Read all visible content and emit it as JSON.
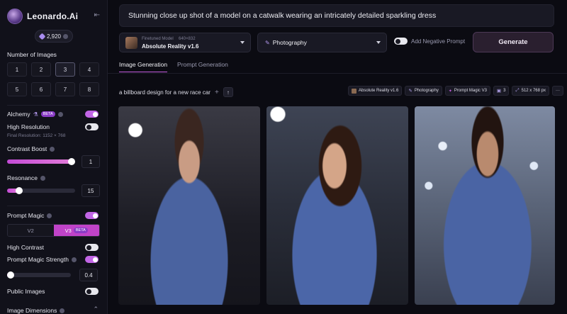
{
  "app": {
    "name": "Leonardo.Ai",
    "token_count": "2,920"
  },
  "sidebar": {
    "number_of_images_label": "Number of Images",
    "number_options": [
      "1",
      "2",
      "3",
      "4",
      "5",
      "6",
      "7",
      "8"
    ],
    "number_selected": "3",
    "alchemy_label": "Alchemy",
    "alchemy_badge": "BETA",
    "alchemy_on": true,
    "high_resolution_label": "High Resolution",
    "high_resolution_on": false,
    "final_resolution": "Final Resolution: 1152 × 768",
    "contrast_boost_label": "Contrast Boost",
    "contrast_boost_value": "1",
    "contrast_boost_fraction": 0.95,
    "resonance_label": "Resonance",
    "resonance_value": "15",
    "resonance_fraction": 0.18,
    "prompt_magic_label": "Prompt Magic",
    "prompt_magic_on": true,
    "version_options": [
      "V2",
      "V3"
    ],
    "version_selected": "V3",
    "version_badge": "BETA",
    "high_contrast_label": "High Contrast",
    "high_contrast_on": false,
    "prompt_magic_strength_label": "Prompt Magic Strength",
    "prompt_magic_strength_on": true,
    "prompt_magic_strength_value": "0.4",
    "prompt_magic_strength_fraction": 0.05,
    "public_images_label": "Public Images",
    "public_images_on": false,
    "image_dimensions_label": "Image Dimensions"
  },
  "prompt": {
    "text": "Stunning close up shot of a model on a catwalk wearing an intricately detailed sparkling dress"
  },
  "model": {
    "kicker": "Finetuned Model",
    "dimensions": "640×832",
    "name": "Absolute Reality v1.6"
  },
  "style": {
    "value": "Photography"
  },
  "negative_prompt": {
    "label": "Add Negative Prompt",
    "on": false
  },
  "generate_label": "Generate",
  "tabs": [
    {
      "label": "Image Generation",
      "active": true
    },
    {
      "label": "Prompt Generation",
      "active": false
    }
  ],
  "history": {
    "prompt": "a billboard design for a new race car",
    "chips": {
      "model": "Absolute Reality v1.6",
      "style": "Photography",
      "magic": "Prompt Magic V3",
      "count": "3",
      "size": "512 x 768 px",
      "more": "···"
    }
  },
  "colors": {
    "accent": "#c45de0",
    "background": "#0b0b12",
    "panel": "#11111a"
  }
}
